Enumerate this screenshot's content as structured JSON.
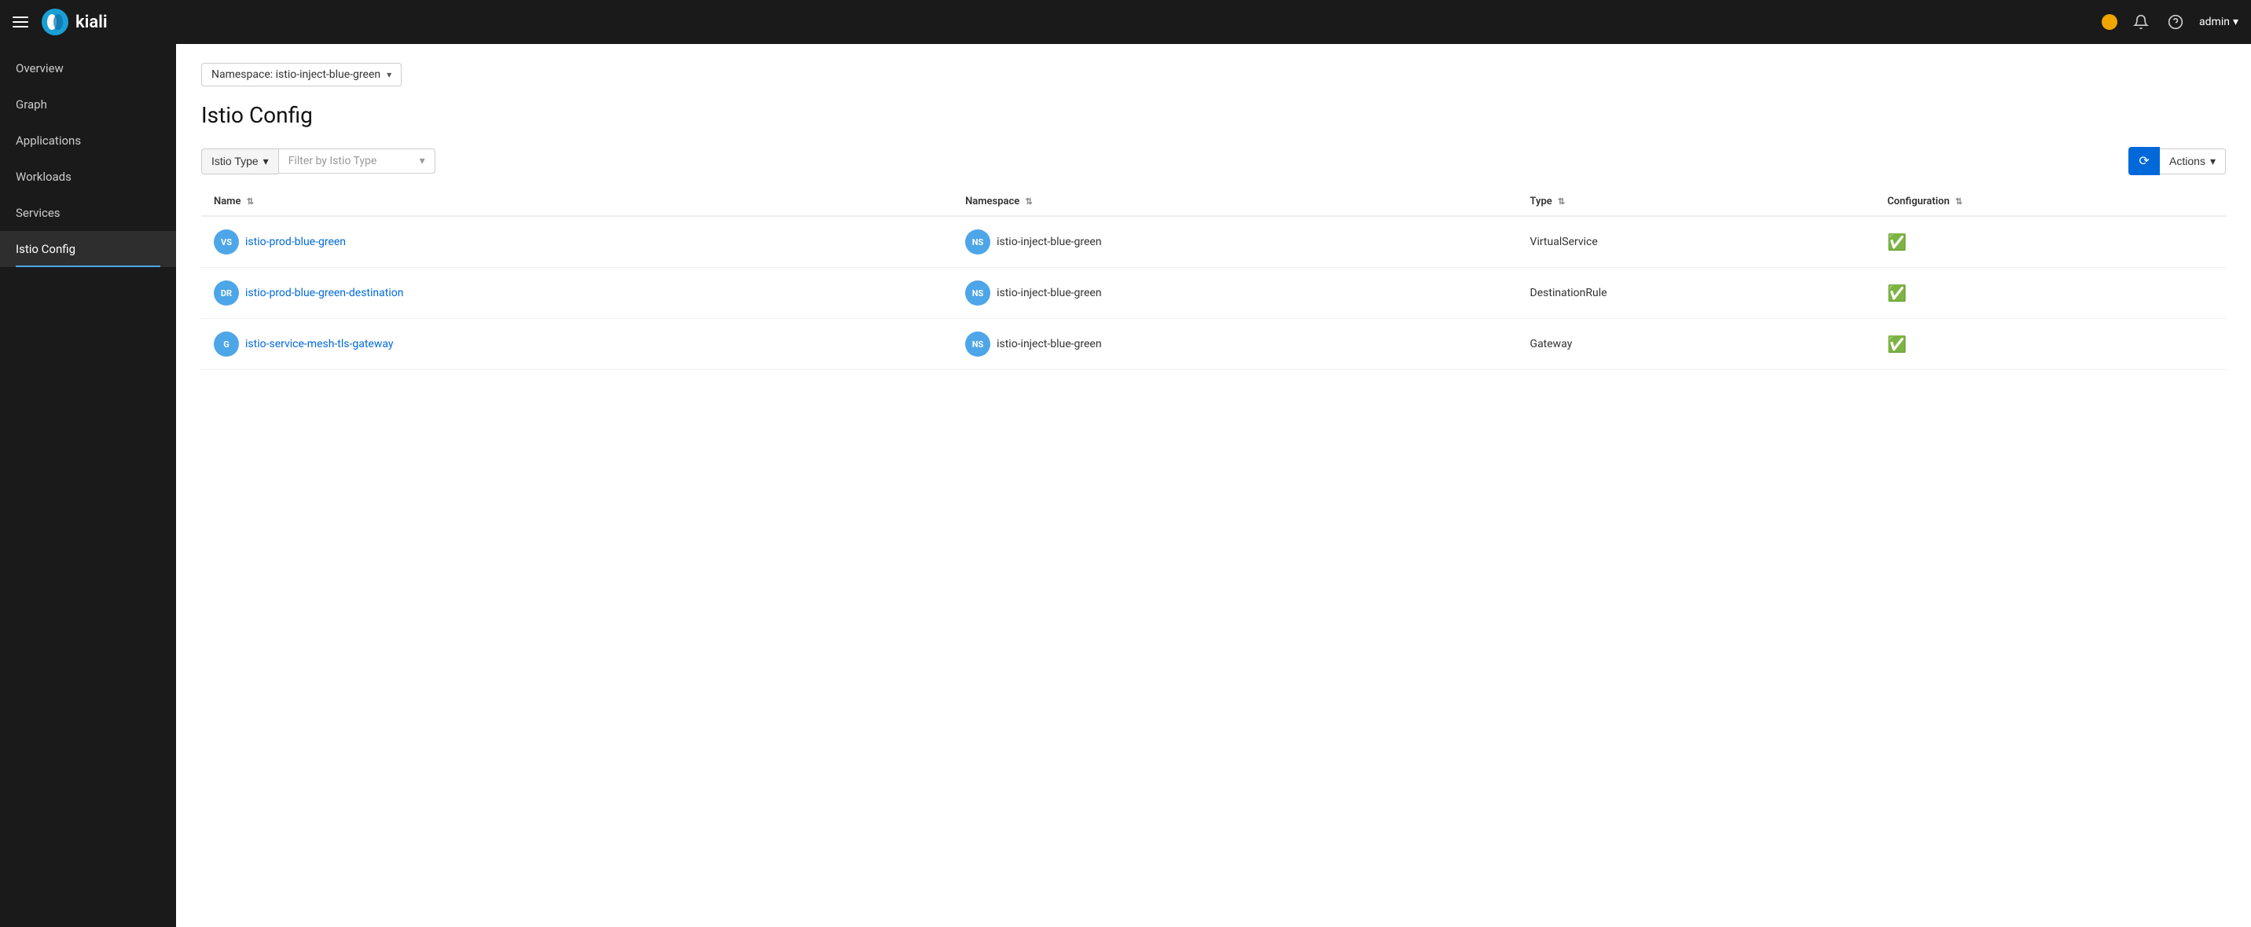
{
  "navbar": {
    "hamburger_label": "Menu",
    "logo_text": "kiali",
    "user_label": "admin",
    "status_icon": "status-dot",
    "bell_icon": "bell-icon",
    "help_icon": "help-icon",
    "chevron_icon": "▾"
  },
  "sidebar": {
    "items": [
      {
        "id": "overview",
        "label": "Overview",
        "active": false
      },
      {
        "id": "graph",
        "label": "Graph",
        "active": false
      },
      {
        "id": "applications",
        "label": "Applications",
        "active": false
      },
      {
        "id": "workloads",
        "label": "Workloads",
        "active": false
      },
      {
        "id": "services",
        "label": "Services",
        "active": false
      },
      {
        "id": "istio-config",
        "label": "Istio Config",
        "active": true
      }
    ]
  },
  "namespace_selector": {
    "label": "Namespace: istio-inject-blue-green"
  },
  "page": {
    "title": "Istio Config"
  },
  "toolbar": {
    "filter_type_label": "Istio Type",
    "filter_placeholder": "Filter by Istio Type",
    "refresh_label": "⟳",
    "actions_label": "Actions",
    "chevron": "▾"
  },
  "table": {
    "columns": [
      {
        "key": "name",
        "label": "Name"
      },
      {
        "key": "namespace",
        "label": "Namespace"
      },
      {
        "key": "type",
        "label": "Type"
      },
      {
        "key": "configuration",
        "label": "Configuration"
      }
    ],
    "rows": [
      {
        "badge": "VS",
        "badge_class": "badge-vs",
        "name": "istio-prod-blue-green",
        "ns_badge": "NS",
        "namespace": "istio-inject-blue-green",
        "type": "VirtualService",
        "valid": true
      },
      {
        "badge": "DR",
        "badge_class": "badge-dr",
        "name": "istio-prod-blue-green-destination",
        "ns_badge": "NS",
        "namespace": "istio-inject-blue-green",
        "type": "DestinationRule",
        "valid": true
      },
      {
        "badge": "G",
        "badge_class": "badge-g",
        "name": "istio-service-mesh-tls-gateway",
        "ns_badge": "NS",
        "namespace": "istio-inject-blue-green",
        "type": "Gateway",
        "valid": true
      }
    ]
  }
}
